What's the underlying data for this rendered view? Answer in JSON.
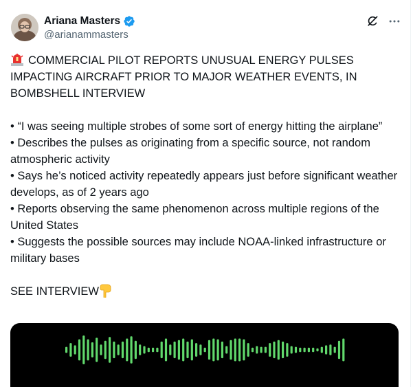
{
  "author": {
    "name": "Ariana Masters",
    "handle": "@arianammasters",
    "verified": true
  },
  "icons": {
    "verified": "verified-badge-icon",
    "grok": "grok-icon",
    "more": "more-options-icon",
    "siren": "rotating-light-emoji",
    "point_down": "backhand-index-pointing-down-emoji"
  },
  "colors": {
    "verified_blue": "#1d9bf0",
    "waveform_green": "#61d96c",
    "text": "#0f1419",
    "secondary": "#536471"
  },
  "post": {
    "headline": "COMMERCIAL PILOT REPORTS UNUSUAL ENERGY PULSES IMPACTING AIRCRAFT PRIOR TO MAJOR WEATHER EVENTS, IN BOMBSHELL INTERVIEW",
    "bullets": [
      "• “I was seeing multiple strobes of some sort of energy hitting the airplane”",
      "• Describes the pulses as originating from a specific source, not random atmospheric activity",
      "• Says he’s noticed activity repeatedly appears just before significant weather develops, as of 2 years ago",
      "• Reports observing the same phenomenon across multiple regions of the United States",
      "• Suggests the possible sources may include NOAA-linked infrastructure or military bases"
    ],
    "cta": "SEE INTERVIEW"
  },
  "media": {
    "type": "audio-waveform-video",
    "waveform_levels": [
      0.2,
      0.45,
      0.3,
      0.7,
      0.95,
      0.7,
      0.5,
      0.8,
      0.35,
      0.6,
      0.85,
      0.55,
      0.35,
      0.55,
      0.75,
      0.9,
      0.6,
      0.35,
      0.25,
      0.15,
      0.15,
      0.15,
      0.55,
      0.75,
      0.35,
      0.55,
      0.65,
      0.75,
      0.55,
      0.7,
      0.45,
      0.35,
      0.15,
      0.65,
      0.75,
      0.7,
      0.55,
      0.25,
      0.65,
      0.75,
      0.75,
      0.7,
      0.45,
      0.15,
      0.25,
      0.2,
      0.2,
      0.45,
      0.55,
      0.65,
      0.55,
      0.45,
      0.25,
      0.2,
      0.15,
      0.15,
      0.15,
      0.15,
      0.1,
      0.2,
      0.3,
      0.35,
      0.2,
      0.6,
      0.75
    ]
  }
}
